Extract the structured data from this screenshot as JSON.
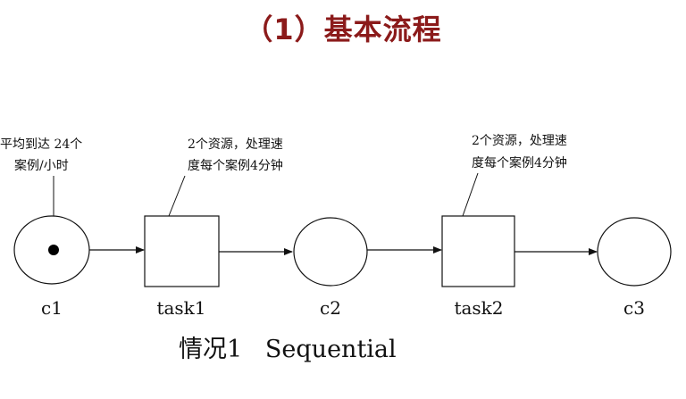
{
  "title": "（1）基本流程",
  "diagram": {
    "places": [
      {
        "id": "c1",
        "label": "c1",
        "has_token": true
      },
      {
        "id": "c2",
        "label": "c2",
        "has_token": false
      },
      {
        "id": "c3",
        "label": "c3",
        "has_token": false
      }
    ],
    "transitions": [
      {
        "id": "task1",
        "label": "task1"
      },
      {
        "id": "task2",
        "label": "task2"
      }
    ],
    "notes": {
      "arrival": [
        "平均到达 24个",
        "案例/小时"
      ],
      "task1": [
        "2个资源，处理速",
        "度每个案例4分钟"
      ],
      "task2": [
        "2个资源，处理速",
        "度每个案例4分钟"
      ]
    },
    "caption": "情况1   Sequential"
  }
}
